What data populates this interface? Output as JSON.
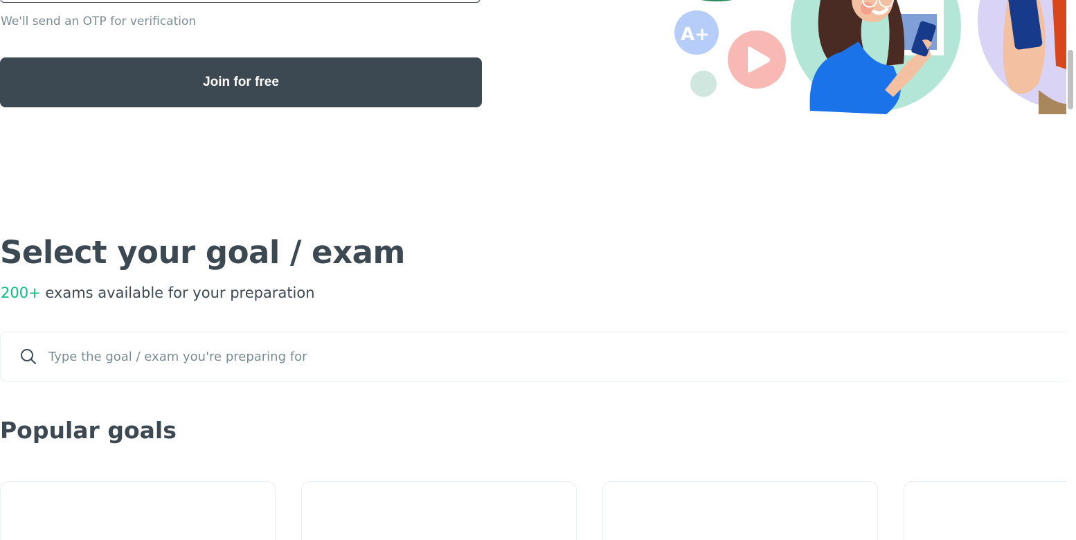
{
  "signup": {
    "otp_note": "We'll send an OTP for verification",
    "join_button_label": "Join for free"
  },
  "illustration": {
    "badge_text": "A+",
    "icons": [
      "grade-badge-icon",
      "play-icon"
    ]
  },
  "goals": {
    "heading": "Select your goal / exam",
    "count_accent": "200+",
    "count_rest": " exams available for your preparation",
    "search_placeholder": "Type the goal / exam you're preparing for",
    "popular_heading": "Popular goals",
    "cards": [
      {},
      {},
      {},
      {}
    ]
  },
  "colors": {
    "primary_dark": "#3c4852",
    "accent_green": "#08bd80",
    "muted_text": "#7a8b94"
  }
}
